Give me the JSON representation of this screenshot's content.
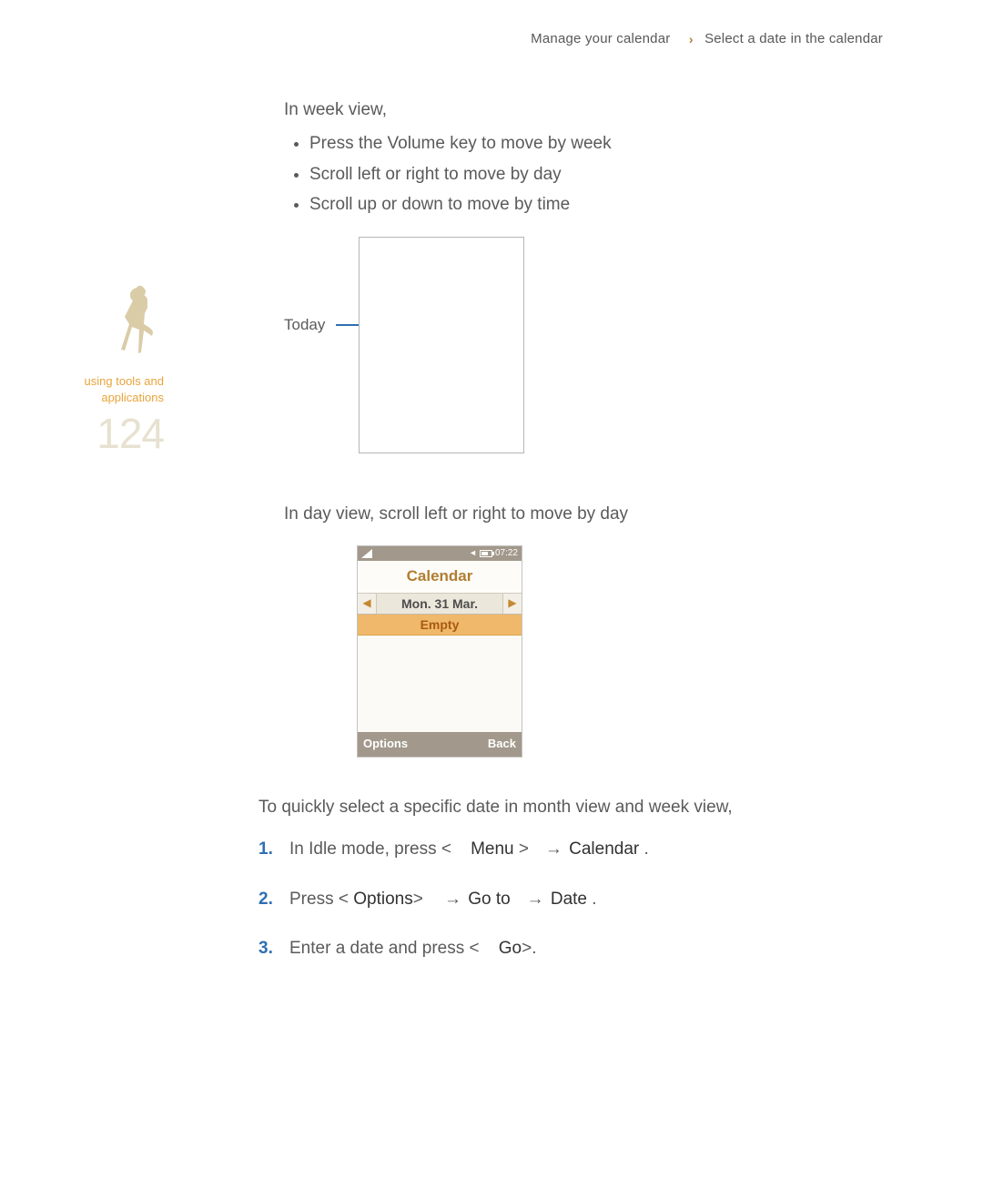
{
  "breadcrumb": {
    "section": "Manage your calendar",
    "subsection": "Select a date in the calendar"
  },
  "sidebar": {
    "caption_line1": "using tools and",
    "caption_line2": "applications",
    "page_number": "124"
  },
  "intro": {
    "week_view_heading": "In week view,",
    "bullet1": "Press the Volume key to move by week",
    "bullet2": "Scroll left or right to move by day",
    "bullet3": "Scroll up or down to move by time",
    "today_label": "Today",
    "day_view_text": "In day view, scroll left or right to move by day"
  },
  "phone": {
    "time": "07:22",
    "title": "Calendar",
    "date": "Mon. 31 Mar.",
    "empty_label": "Empty",
    "softkey_left": "Options",
    "softkey_right": "Back"
  },
  "quick_select": {
    "lead": "To quickly select a specific date in month view and week view,",
    "step1_a": "In Idle mode, press <",
    "step1_menu": "Menu",
    "step1_gt": ">",
    "step1_arrow": "→",
    "step1_calendar": "Calendar",
    "step1_period": ".",
    "step2_a": "Press <",
    "step2_options": "Options",
    "step2_gt": ">",
    "step2_arrow1": "→",
    "step2_goto": "Go to",
    "step2_arrow2": "→",
    "step2_date": "Date",
    "step2_period": ".",
    "step3_a": "Enter a date and press <",
    "step3_go": "Go",
    "step3_end": ">."
  }
}
